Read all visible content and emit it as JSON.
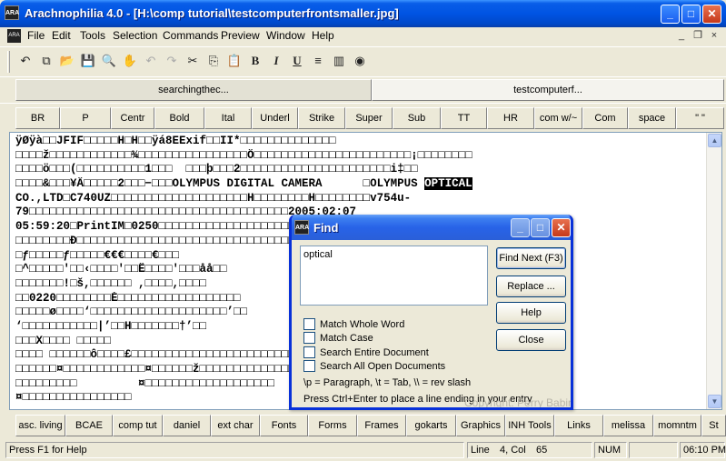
{
  "window": {
    "title": "Arachnophilia 4.0 - [H:\\comp tutorial\\testcomputerfrontsmaller.jpg]",
    "icon_label": "ARA",
    "minimize": "_",
    "maximize": "□",
    "close": "✕"
  },
  "menu": {
    "items": [
      "File",
      "Edit",
      "Tools",
      "Selection",
      "Commands",
      "Preview",
      "Window",
      "Help"
    ],
    "mdi_minimize": "_",
    "mdi_restore": "❐",
    "mdi_close": "×"
  },
  "toolbar": {
    "icons": {
      "open_glyph": "↶",
      "copy_glyph": "⧉",
      "folder_glyph": "📂",
      "save_glyph": "💾",
      "find_glyph": "🔍",
      "hand_glyph": "✋",
      "undo_glyph": "↶",
      "redo_glyph": "↷",
      "cut_glyph": "✂",
      "copy2_glyph": "⎘",
      "paste_glyph": "📋",
      "bold_glyph": "B",
      "italic_glyph": "I",
      "underline_glyph": "U",
      "justify_glyph": "≡",
      "chart_glyph": "▥",
      "globe_glyph": "◉"
    }
  },
  "doc_tabs": [
    "searchingthec...",
    "testcomputerf..."
  ],
  "tag_buttons": [
    "BR",
    "P",
    "Centr",
    "Bold",
    "Ital",
    "Underl",
    "Strike",
    "Super",
    "Sub",
    "TT",
    "HR",
    "com w/~",
    "Com",
    "space",
    "\" \""
  ],
  "editor": {
    "lines": [
      "ÿØÿà□□JFIF□□□□□H□H□□ÿá8EExif□□II*□□□□□□□□□□□□□□",
      "□□□□ž□□□□□□□□□□□□¾□□□□□□□□□□□□□□□□Ö□□□□□□□□□□□□□□□□□□□□□□□¡□□□□□□□□",
      "□□□□ö□□□(□□□□□□□□□□1□□□  □□□þ□□□2□□□□□□□□□□□□□□□□□□□□□□i‡□□",
      "□□□□&□□□¥Ä□□□□□2□□□−□□□OLYMPUS DIGITAL CAMERA      □OLYMPUS ",
      "CO.,LTD□C740UZ□□□□□□□□□□□□□□□□□□□□H□□□□□□□□H□□□□□□□□v754u-",
      "79□□□□□□□□□□□□□□□□□□□□□□□□□□□□□□□□□□□□□□2005:02:07",
      "05:59:20□PrintIM□0250□□□□□□□□□□□□□□□□□□□□□□□□□□□□□□□□□□□□□□□  □□□□□",
      "□□□□□□□□Đ□□□□□□□□□□□□□□□□□□□□□□□□□□□□□□□□□□□□□□□□□□ƒ□□□□□ƒ□□□□",
      "□ƒ□□□□□ƒ□□□□□€€€□□□□€□□□                          □□'□□□□□□□'□",
      "□^□□□□□'□□‹□□□□'□□Ë□□□□'□□□åå□□                   □'□□□□□□□□□□",
      "□□□□□□□!□š,□□□□□□ ,□□□□,□□□□                      □d□□□□□□□□□□",
      "□□0220□□□□□□□□È□□□□□□□□□□□□□□□□□□                    □□□□□□□’",
      "□□□□□ø□□□□‘□□□□□□□□□□□□□□□□□□□□’□□                 ‘□□□□□□□□□□□□",
      "‘□□□□□□□□□□□|’□□H□□□□□□□†’□□                     □□□□□□□ □□□□□",
      "□□□X□□□□ □□□□□",
      "□□□□ □□□□□□ô□□□□£□□□□□□□□□□□□□□□□□□□□□□□□□□□□□□□□□□□□¤□□□□□□□□",
      "□□□□□□¤□□□□□□□□□□□□¤□□□□□□ž□□□□□□□□□□□□□□□□□□□□□¤□□□□□□□□□□¤□□□□□□□□",
      "□□□□□□□□□         ¤□□□□□□□□□□□□□□□□□□□",
      "¤□□□□□□□□□□□□□□□□"
    ],
    "highlight": "OPTICAL",
    "scroll_up": "▲",
    "scroll_down": "▼"
  },
  "snippets": [
    "asc. living",
    "BCAE",
    "comp tut",
    "daniel",
    "ext char",
    "Fonts",
    "Forms",
    "Frames",
    "gokarts",
    "Graphics",
    "INH Tools",
    "Links",
    "melissa",
    "momntm",
    "St"
  ],
  "status": {
    "help": "Press F1 for Help",
    "line_label": "Line",
    "line_value": "4, Col",
    "col_value": "65",
    "num": "NUM",
    "time": "06:10 PM"
  },
  "find_dialog": {
    "title": "Find",
    "search_text": "optical",
    "buttons": [
      "Find Next (F3)",
      "Replace ...",
      "Help",
      "Close"
    ],
    "options": [
      {
        "label": "Match Whole Word",
        "checked": false
      },
      {
        "label": "Match Case",
        "checked": false
      },
      {
        "label": "Search Entire Document",
        "checked": false
      },
      {
        "label": "Search All Open Documents",
        "checked": false
      }
    ],
    "note1": "\\p = Paragraph, \\t = Tab, \\\\ = rev slash",
    "note2": "Press Ctrl+Enter to place a line ending in your entry",
    "watermark": "Copyright: Perry Babin"
  }
}
